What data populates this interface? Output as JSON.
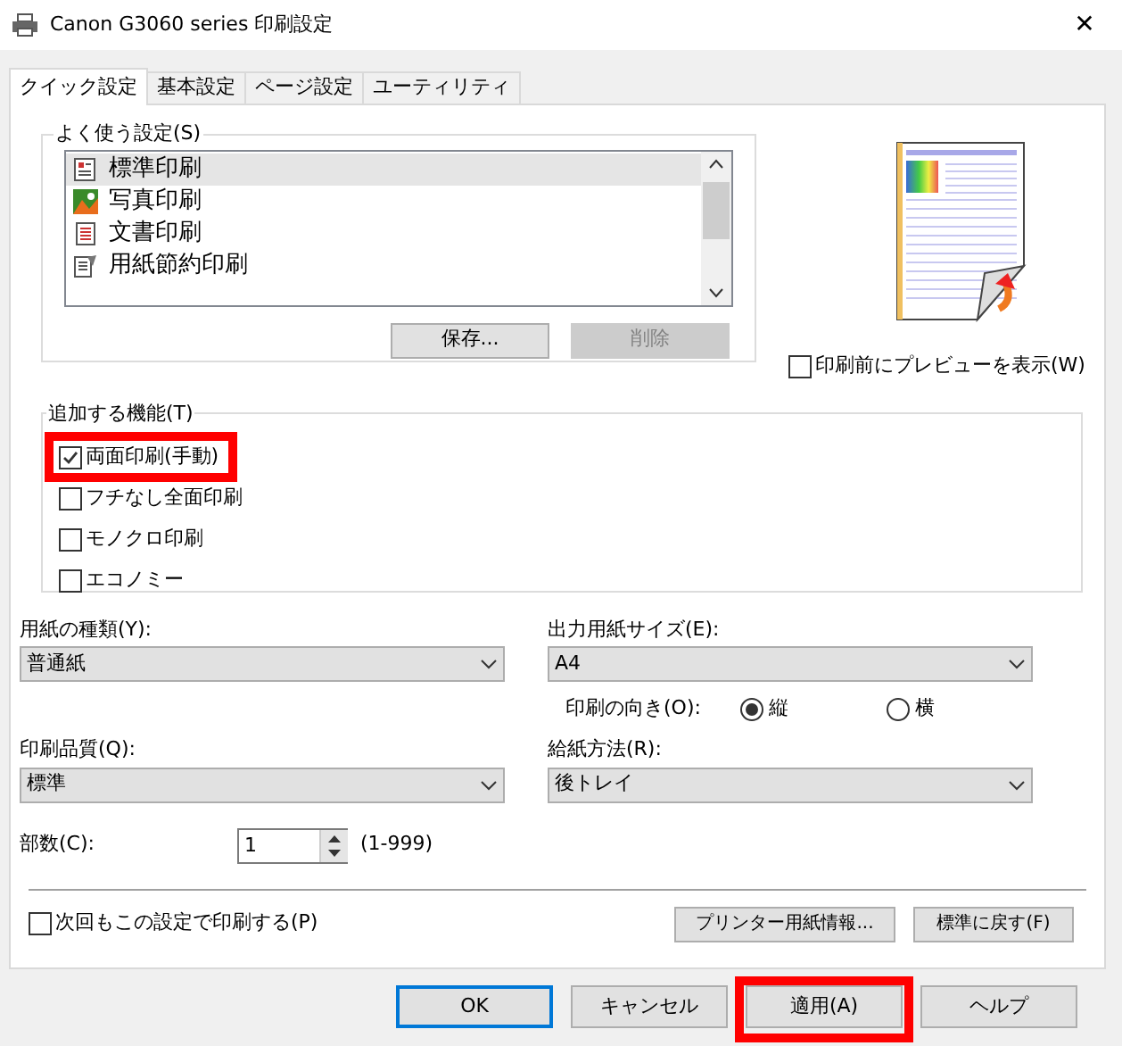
{
  "window": {
    "title": "Canon G3060 series 印刷設定",
    "close": "✕"
  },
  "tabs": [
    {
      "label": "クイック設定",
      "selected": true
    },
    {
      "label": "基本設定",
      "selected": false
    },
    {
      "label": "ページ設定",
      "selected": false
    },
    {
      "label": "ユーティリティ",
      "selected": false
    }
  ],
  "favorites": {
    "label": "よく使う設定(S)",
    "items": [
      {
        "label": "標準印刷",
        "selected": true
      },
      {
        "label": "写真印刷",
        "selected": false
      },
      {
        "label": "文書印刷",
        "selected": false
      },
      {
        "label": "用紙節約印刷",
        "selected": false
      }
    ],
    "save_button": {
      "label": "保存...",
      "disabled": false
    },
    "delete_button": {
      "label": "削除",
      "disabled": true
    }
  },
  "preview_checkbox": {
    "label": "印刷前にプレビューを表示(W)",
    "checked": false
  },
  "features": {
    "label": "追加する機能(T)",
    "items": [
      {
        "label": "両面印刷(手動)",
        "checked": true,
        "highlighted": true
      },
      {
        "label": "フチなし全面印刷",
        "checked": false,
        "highlighted": false
      },
      {
        "label": "モノクロ印刷",
        "checked": false,
        "highlighted": false
      },
      {
        "label": "エコノミー",
        "checked": false,
        "highlighted": false
      }
    ]
  },
  "media_type": {
    "label": "用紙の種類(Y):",
    "value": "普通紙"
  },
  "output_size": {
    "label": "出力用紙サイズ(E):",
    "value": "A4"
  },
  "orientation": {
    "label": "印刷の向き(O):",
    "options": [
      {
        "label": "縦",
        "selected": true
      },
      {
        "label": "横",
        "selected": false
      }
    ]
  },
  "quality": {
    "label": "印刷品質(Q):",
    "value": "標準"
  },
  "paper_source": {
    "label": "給紙方法(R):",
    "value": "後トレイ"
  },
  "copies": {
    "label": "部数(C):",
    "value": "1",
    "range": "(1-999)"
  },
  "always_print_checkbox": {
    "label": "次回もこの設定で印刷する(P)",
    "checked": false
  },
  "panel_buttons": [
    "プリンター用紙情報...",
    "標準に戻す(F)"
  ],
  "dialog_buttons": [
    {
      "label": "OK",
      "default": true,
      "highlighted": false
    },
    {
      "label": "キャンセル",
      "default": false,
      "highlighted": false
    },
    {
      "label": "適用(A)",
      "default": false,
      "highlighted": true
    },
    {
      "label": "ヘルプ",
      "default": false,
      "highlighted": false
    }
  ]
}
